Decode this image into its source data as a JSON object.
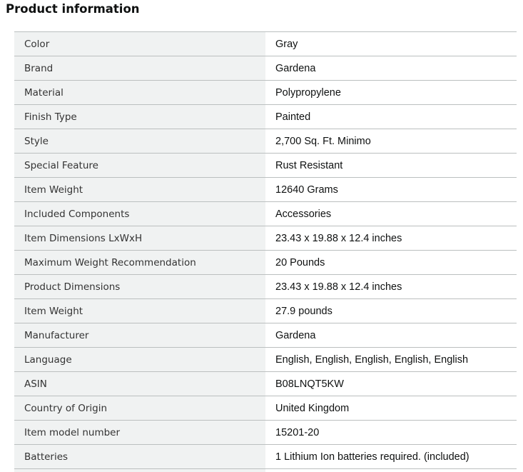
{
  "header": {
    "title": "Product information"
  },
  "table": {
    "rows": [
      {
        "label": "Color",
        "value": "Gray"
      },
      {
        "label": "Brand",
        "value": "Gardena"
      },
      {
        "label": "Material",
        "value": "Polypropylene"
      },
      {
        "label": "Finish Type",
        "value": "Painted"
      },
      {
        "label": "Style",
        "value": "2,700 Sq. Ft. Minimo"
      },
      {
        "label": "Special Feature",
        "value": "Rust Resistant"
      },
      {
        "label": "Item Weight",
        "value": "12640 Grams"
      },
      {
        "label": "Included Components",
        "value": "Accessories"
      },
      {
        "label": "Item Dimensions LxWxH",
        "value": "23.43 x 19.88 x 12.4 inches"
      },
      {
        "label": "Maximum Weight Recommendation",
        "value": "20 Pounds"
      },
      {
        "label": "Product Dimensions",
        "value": "23.43 x 19.88 x 12.4 inches"
      },
      {
        "label": "Item Weight",
        "value": "27.9 pounds"
      },
      {
        "label": "Manufacturer",
        "value": "Gardena"
      },
      {
        "label": "Language",
        "value": "English, English, English, English, English"
      },
      {
        "label": "ASIN",
        "value": "B08LNQT5KW"
      },
      {
        "label": "Country of Origin",
        "value": "United Kingdom"
      },
      {
        "label": "Item model number",
        "value": "15201-20"
      },
      {
        "label": "Batteries",
        "value": "1 Lithium Ion batteries required. (included)"
      }
    ]
  },
  "colors": {
    "label_background": "#f0f2f2",
    "row_border": "#bbbfbf",
    "text": "#0F1111"
  }
}
